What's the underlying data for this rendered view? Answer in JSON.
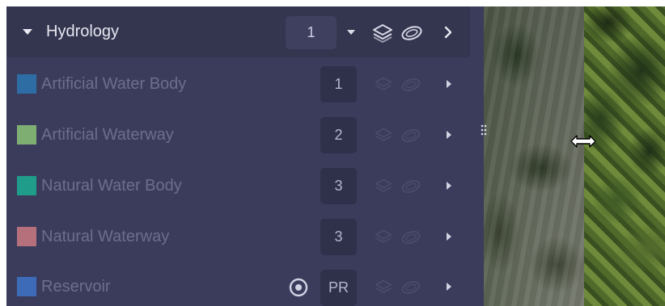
{
  "group": {
    "title": "Hydrology",
    "order": "1"
  },
  "layers": [
    {
      "label": "Artificial Water Body",
      "order": "1",
      "color": "#2e6da3"
    },
    {
      "label": "Artificial Waterway",
      "order": "2",
      "color": "#7fae72"
    },
    {
      "label": "Natural Water Body",
      "order": "3",
      "color": "#1f9c8a"
    },
    {
      "label": "Natural Waterway",
      "order": "3",
      "color": "#b5707c"
    },
    {
      "label": "Reservoir",
      "order": "PR",
      "color": "#3d6bb8"
    }
  ],
  "icons": {
    "expand": "caret-down-icon",
    "dropdown": "caret-down-icon",
    "layers": "layers-icon",
    "outline": "polygon-outline-icon",
    "details": "chevron-right-icon",
    "focus": "target-icon",
    "splitter_grip": "grip-dots-icon",
    "cursor": "resize-horizontal-icon"
  },
  "colors": {
    "panel_bg": "#3b3c5c",
    "header_bg": "#34354f"
  }
}
